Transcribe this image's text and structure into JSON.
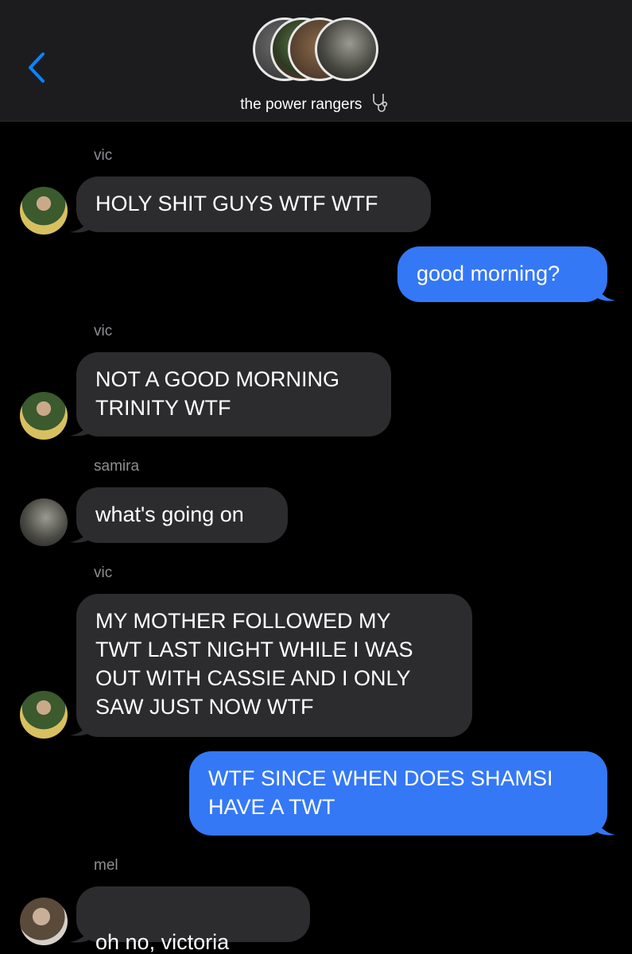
{
  "header": {
    "group_name": "the power rangers",
    "back_icon": "chevron-left-icon",
    "title_icon": "stethoscope-icon"
  },
  "colors": {
    "incoming_bubble": "#2c2c2e",
    "outgoing_bubble": "#3478f6",
    "accent": "#0a84ff",
    "sender_name": "#8e8e93"
  },
  "messages": [
    {
      "direction": "in",
      "sender": "vic",
      "text": "HOLY SHIT GUYS WTF WTF"
    },
    {
      "direction": "out",
      "text": "good morning?"
    },
    {
      "direction": "in",
      "sender": "vic",
      "text": "NOT A GOOD MORNING\nTRINITY WTF"
    },
    {
      "direction": "in",
      "sender": "samira",
      "text": "what's going on"
    },
    {
      "direction": "in",
      "sender": "vic",
      "text": "MY MOTHER FOLLOWED MY\nTWT LAST NIGHT WHILE I WAS\nOUT WITH CASSIE AND I ONLY\nSAW JUST NOW WTF"
    },
    {
      "direction": "out",
      "text": "WTF SINCE WHEN DOES SHAMSI\nHAVE A TWT"
    },
    {
      "direction": "in",
      "sender": "mel",
      "text": "oh no, victoria",
      "emoji": "😭"
    }
  ]
}
